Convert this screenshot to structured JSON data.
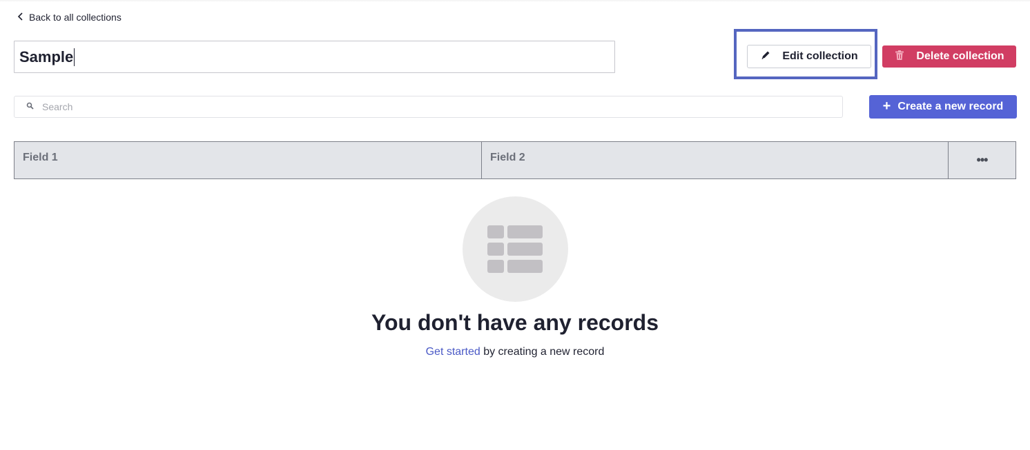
{
  "nav": {
    "back_label": "Back to all collections"
  },
  "collection": {
    "title_value": "Sample"
  },
  "toolbar": {
    "edit_label": "Edit collection",
    "delete_label": "Delete collection",
    "create_label": "Create a new record"
  },
  "search": {
    "placeholder": "Search",
    "value": ""
  },
  "table": {
    "columns": [
      "Field 1",
      "Field 2"
    ],
    "more_label": "•••"
  },
  "empty_state": {
    "title": "You don't have any records",
    "link_text": "Get started",
    "rest_text": " by creating a new record"
  },
  "colors": {
    "accent": "#5563d6",
    "danger": "#d13d63",
    "highlight": "#5566c0"
  }
}
